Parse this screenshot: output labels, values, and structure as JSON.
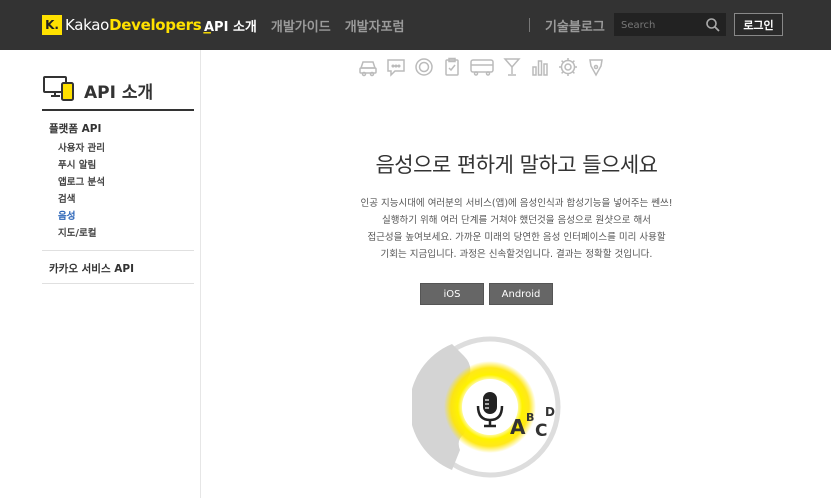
{
  "header": {
    "logo_mark": "K.",
    "logo_name_plain": "Kakao",
    "logo_name_bold": "Developers",
    "logo_cursor": "_",
    "nav": [
      {
        "label": "API 소개",
        "active": true
      },
      {
        "label": "개발가이드",
        "active": false
      },
      {
        "label": "개발자포럼",
        "active": false
      }
    ],
    "blog": "기술블로그",
    "search_placeholder": "Search",
    "login": "로그인",
    "accent": "#ffe100",
    "bg": "#333333"
  },
  "sidebar": {
    "title": "API 소개",
    "categories": [
      {
        "label": "플랫폼 API",
        "items": [
          {
            "label": "사용자 관리",
            "active": false
          },
          {
            "label": "푸시 알림",
            "active": false
          },
          {
            "label": "앱로그 분석",
            "active": false
          },
          {
            "label": "검색",
            "active": false
          },
          {
            "label": "음성",
            "active": true
          },
          {
            "label": "지도/로컬",
            "active": false
          }
        ]
      },
      {
        "label": "카카오 서비스 API",
        "items": []
      }
    ],
    "active_color": "#2a64b8"
  },
  "main": {
    "top_icons": [
      "car-icon",
      "chat-icon",
      "coin-icon",
      "clipboard-icon",
      "bus-icon",
      "cocktail-icon",
      "bar-chart-icon",
      "gear-icon",
      "pen-nib-icon"
    ],
    "headline": "음성으로 편하게 말하고 들으세요",
    "description": [
      "인공 지능시대에 여러분의 서비스(앱)에 음성인식과 합성기능을 넣어주는 쎈쓰!",
      "실행하기 위해 여러 단계를 거쳐야 했던것을 음성으로 원샷으로 해서",
      "접근성을 높여보세요. 가까운 미래의 당연한 음성 인터페이스를 미리 사용할",
      "기회는 지금입니다. 과정은 신속할것입니다. 결과는 정확할 것입니다."
    ],
    "buttons": {
      "ios": "iOS",
      "android": "Android"
    },
    "illustration": {
      "letters": [
        "A",
        "B",
        "C",
        "D"
      ],
      "glow_color": "#ffe600"
    }
  }
}
